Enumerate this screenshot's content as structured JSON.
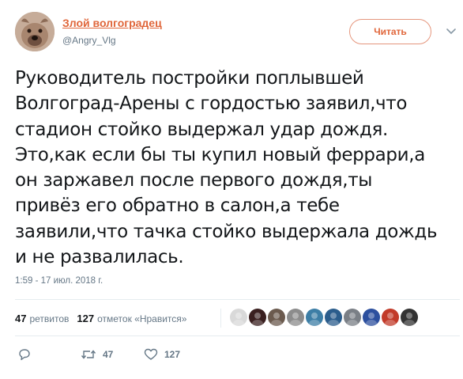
{
  "author": {
    "name": "Злой волгоградец",
    "handle": "@Angry_Vlg"
  },
  "follow_button": {
    "label": "Читать"
  },
  "tweet": {
    "text": "Руководитель постройки поплывшей\nВолгоград-Арены с гордостью заявил,что\nстадион стойко выдержал удар дождя.\nЭто,как если бы ты купил новый феррари,а\nон заржавел после первого дождя,ты\nпривёз его обратно в салон,а тебе\nзаявили,что тачка стойко выдержала дождь\nи не развалилась.",
    "timestamp": "1:59 - 17 июл. 2018 г."
  },
  "stats": {
    "retweets_count": "47",
    "retweets_label": "ретвитов",
    "likes_count": "127",
    "likes_label": "отметок «Нравится»"
  },
  "actions": {
    "reply_count": "",
    "retweet_count": "47",
    "like_count": "127"
  },
  "colors": {
    "accent": "#e0663a",
    "secondary_text": "#657786",
    "divider": "#e6ecf0"
  },
  "likers": [
    {
      "color": "#d9d9d9",
      "icon": "avatar"
    },
    {
      "color": "#3a1f1f",
      "icon": "avatar"
    },
    {
      "color": "#6b5a4e",
      "icon": "avatar"
    },
    {
      "color": "#8c8c8c",
      "icon": "avatar"
    },
    {
      "color": "#3d7ea6",
      "icon": "avatar"
    },
    {
      "color": "#2b5d8c",
      "icon": "avatar"
    },
    {
      "color": "#7a7f86",
      "icon": "avatar"
    },
    {
      "color": "#2c4f9e",
      "icon": "avatar"
    },
    {
      "color": "#c23b2a",
      "icon": "avatar"
    },
    {
      "color": "#333333",
      "icon": "avatar"
    }
  ]
}
